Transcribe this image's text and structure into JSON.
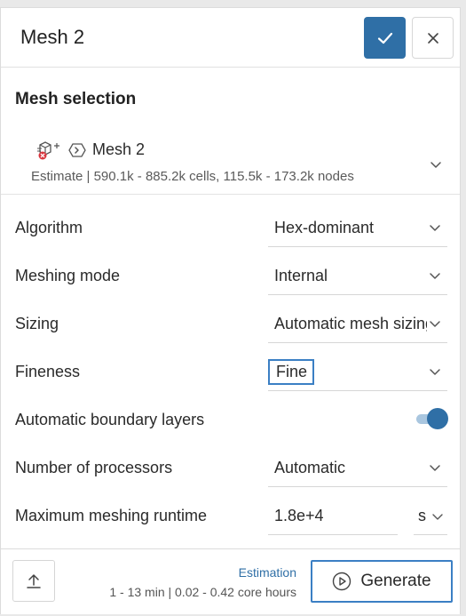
{
  "header": {
    "title": "Mesh 2",
    "confirm_icon": "checkmark-icon",
    "close_icon": "close-icon"
  },
  "mesh_selection": {
    "section_title": "Mesh selection",
    "mesh_name": "Mesh 2",
    "estimate": "Estimate | 590.1k - 885.2k cells, 115.5k - 173.2k nodes"
  },
  "form": {
    "algorithm": {
      "label": "Algorithm",
      "value": "Hex-dominant"
    },
    "meshing_mode": {
      "label": "Meshing mode",
      "value": "Internal"
    },
    "sizing": {
      "label": "Sizing",
      "value": "Automatic mesh sizing"
    },
    "fineness": {
      "label": "Fineness",
      "value": "Fine"
    },
    "boundary_layers": {
      "label": "Automatic boundary layers",
      "enabled": true
    },
    "processors": {
      "label": "Number of processors",
      "value": "Automatic"
    },
    "runtime": {
      "label": "Maximum meshing runtime",
      "value": "1.8e+4",
      "unit": "s"
    }
  },
  "footer": {
    "estimation_title": "Estimation",
    "estimation_values": "1 - 13 min | 0.02 - 0.42 core hours",
    "generate_label": "Generate"
  },
  "colors": {
    "accent": "#2f6fa6",
    "focus": "#3b7fc4"
  }
}
